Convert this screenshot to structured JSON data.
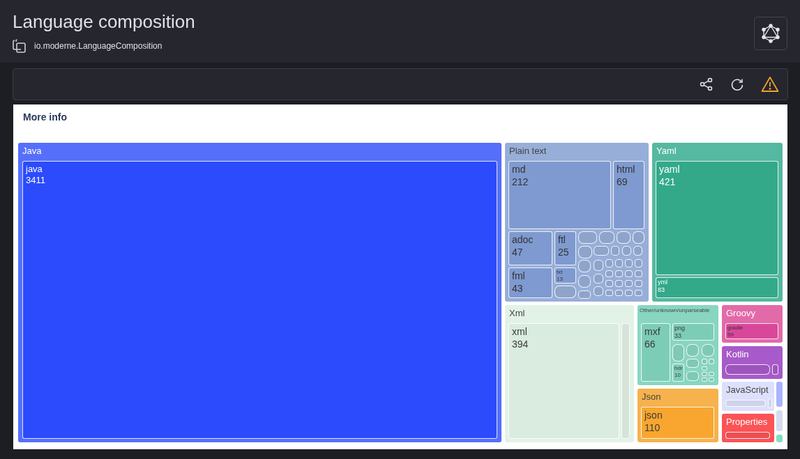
{
  "header": {
    "title": "Language composition",
    "recipe_id": "io.moderne.LanguageComposition"
  },
  "panel": {
    "heading": "More info"
  },
  "treemap": {
    "groups": [
      {
        "name": "Java",
        "color": "#566ffb",
        "children": [
          {
            "label": "java",
            "value": "3411",
            "color": "#2b4bfc"
          }
        ]
      },
      {
        "name": "Plain text",
        "color": "#97aed8",
        "children": [
          {
            "label": "md",
            "value": "212",
            "color": "#7f9ad0"
          },
          {
            "label": "html",
            "value": "69",
            "color": "#7f9ad0"
          },
          {
            "label": "adoc",
            "value": "47",
            "color": "#7f9ad0"
          },
          {
            "label": "ftl",
            "value": "25",
            "color": "#7f9ad0"
          },
          {
            "label": "fml",
            "value": "43",
            "color": "#7f9ad0"
          },
          {
            "label": "txt",
            "value": "13",
            "color": "#7f9ad0"
          }
        ]
      },
      {
        "name": "Yaml",
        "color": "#55b8a0",
        "children": [
          {
            "label": "yaml",
            "value": "421",
            "color": "#33a98a"
          },
          {
            "label": "yml",
            "value": "83",
            "color": "#33a98a"
          }
        ]
      },
      {
        "name": "Xml",
        "color": "#e3f2e7",
        "children": [
          {
            "label": "xml",
            "value": "394",
            "color": "#d9ecdf"
          }
        ]
      },
      {
        "name": "Other/unknown/unparseable",
        "color": "#88d6c0",
        "children": [
          {
            "label": "mxf",
            "value": "66",
            "color": "#7dcdb6"
          },
          {
            "label": "png",
            "value": "33",
            "color": "#7dcdb6"
          },
          {
            "label": "hdr",
            "value": "10",
            "color": "#7dcdb6"
          }
        ]
      },
      {
        "name": "Json",
        "color": "#f6b24c",
        "children": [
          {
            "label": "json",
            "value": "110",
            "color": "#f8a630"
          }
        ]
      },
      {
        "name": "Groovy",
        "color": "#e26aa8",
        "children": [
          {
            "label": "gradle",
            "value": "59",
            "color": "#d9479a"
          }
        ]
      },
      {
        "name": "Kotlin",
        "color": "#a75ac9"
      },
      {
        "name": "JavaScript",
        "color": "#dde0fb"
      },
      {
        "name": "Properties",
        "color": "#fb5356"
      }
    ]
  }
}
